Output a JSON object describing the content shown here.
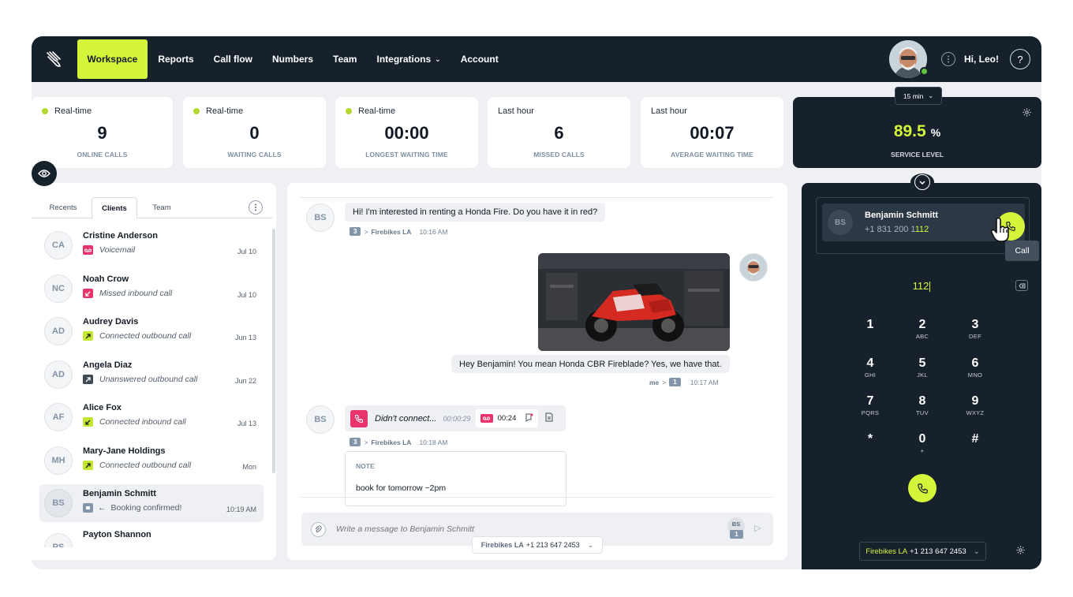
{
  "nav": {
    "items": [
      {
        "label": "Workspace",
        "active": true
      },
      {
        "label": "Reports"
      },
      {
        "label": "Call flow"
      },
      {
        "label": "Numbers"
      },
      {
        "label": "Team"
      },
      {
        "label": "Integrations",
        "dropdown": true
      },
      {
        "label": "Account"
      }
    ],
    "greeting": "Hi, Leo!",
    "help_glyph": "?"
  },
  "stats": [
    {
      "label": "Real-time",
      "live": true,
      "value": "9",
      "caption": "ONLINE CALLS"
    },
    {
      "label": "Real-time",
      "live": true,
      "value": "0",
      "caption": "WAITING CALLS"
    },
    {
      "label": "Real-time",
      "live": true,
      "value": "00:00",
      "caption": "LONGEST WAITING TIME"
    },
    {
      "label": "Last hour",
      "live": false,
      "value": "6",
      "caption": "MISSED CALLS"
    },
    {
      "label": "Last hour",
      "live": false,
      "value": "00:07",
      "caption": "AVERAGE WAITING TIME"
    }
  ],
  "service_level": {
    "period": "15 min",
    "value": "89.5",
    "unit": "%",
    "caption": "SERVICE LEVEL"
  },
  "left": {
    "tabs": [
      "Recents",
      "Clients",
      "Team"
    ],
    "active_tab": "Clients",
    "clients": [
      {
        "initials": "CA",
        "name": "Cristine Anderson",
        "status": "Voicemail",
        "date": "Jul 10",
        "icon": "voicemail-icon",
        "icon_color": "#e8336d"
      },
      {
        "initials": "NC",
        "name": "Noah Crow",
        "status": "Missed inbound call",
        "date": "Jul 10",
        "icon": "missed-call-icon",
        "icon_color": "#e8336d"
      },
      {
        "initials": "AD",
        "name": "Audrey Davis",
        "status": "Connected outbound call",
        "date": "Jun 13",
        "icon": "outbound-call-icon",
        "icon_color": "#c3e82f"
      },
      {
        "initials": "AD",
        "name": "Angela Diaz",
        "status": "Unanswered outbound call",
        "date": "Jun 22",
        "icon": "unanswered-call-icon",
        "icon_color": "#3e4a56"
      },
      {
        "initials": "AF",
        "name": "Alice Fox",
        "status": "Connected inbound call",
        "date": "Jul 13",
        "icon": "inbound-call-icon",
        "icon_color": "#c3e82f"
      },
      {
        "initials": "MH",
        "name": "Mary-Jane Holdings",
        "status": "Connected outbound call",
        "date": "Mon",
        "icon": "outbound-call-icon",
        "icon_color": "#c3e82f"
      },
      {
        "initials": "BS",
        "name": "Benjamin Schmitt",
        "status": "Booking confirmed!",
        "date": "10:19 AM",
        "icon": "message-icon",
        "icon_color": "#8395a9",
        "selected": true
      },
      {
        "initials": "PS",
        "name": "Payton Shannon",
        "status": "",
        "date": ""
      }
    ]
  },
  "chat": {
    "contact_initials": "BS",
    "msg1": {
      "text": "Hi! I'm interested in renting a Honda Fire. Do you have it in red?",
      "count": "3",
      "line": "Firebikes LA",
      "time": "10:16 AM"
    },
    "msg2": {
      "text": "Hey Benjamin! You mean Honda CBR Fireblade? Yes, we have that.",
      "sender": "me",
      "count": "1",
      "time": "10:17 AM"
    },
    "call": {
      "status": "Didn't connect...",
      "duration": "00:00:29",
      "voicemail_length": "00:24",
      "count": "3",
      "line": "Firebikes LA",
      "time": "10:18 AM"
    },
    "note": {
      "title": "NOTE",
      "text": "book for tomorrow ~2pm"
    },
    "composer": {
      "placeholder": "Write a message to Benjamin Schmitt",
      "badge_initials": "BS",
      "badge_count": "1"
    },
    "number_select": {
      "line": "Firebikes LA",
      "number": "+1 213 647 2453"
    }
  },
  "dialer": {
    "contact": {
      "initials": "BS",
      "name": "Benjamin Schmitt",
      "number_prefix": "+1 831 200 1",
      "number_match": "112"
    },
    "tooltip": "Call",
    "input": "112",
    "keys": [
      {
        "d": "1",
        "l": ""
      },
      {
        "d": "2",
        "l": "ABC"
      },
      {
        "d": "3",
        "l": "DEF"
      },
      {
        "d": "4",
        "l": "GHI"
      },
      {
        "d": "5",
        "l": "JKL"
      },
      {
        "d": "6",
        "l": "MNO"
      },
      {
        "d": "7",
        "l": "PQRS"
      },
      {
        "d": "8",
        "l": "TUV"
      },
      {
        "d": "9",
        "l": "WXYZ"
      },
      {
        "d": "*",
        "l": ""
      },
      {
        "d": "0",
        "l": "+"
      },
      {
        "d": "#",
        "l": ""
      }
    ],
    "from": {
      "line": "Firebikes LA",
      "number": "+1 213 647 2453"
    }
  },
  "colors": {
    "accent": "#d5f53b",
    "dark": "#17212c",
    "missed": "#e8336d"
  }
}
